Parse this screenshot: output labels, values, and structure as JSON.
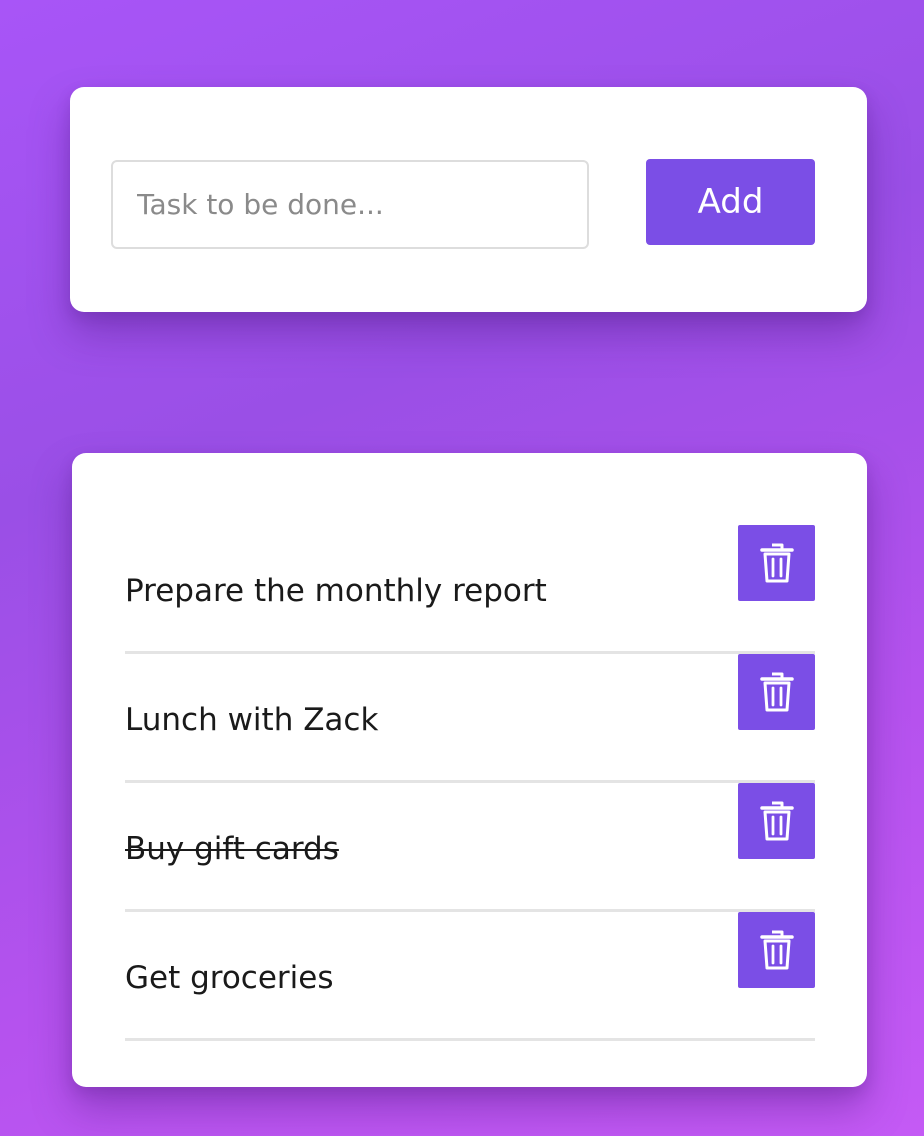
{
  "input_card": {
    "input_value": "",
    "input_placeholder": "Task to be done...",
    "add_label": "Add"
  },
  "tasks": [
    {
      "text": "Prepare the monthly report",
      "completed": false,
      "delete_icon": "trash-icon"
    },
    {
      "text": "Lunch with Zack",
      "completed": false,
      "delete_icon": "trash-icon"
    },
    {
      "text": "Buy gift cards",
      "completed": true,
      "delete_icon": "trash-icon"
    },
    {
      "text": "Get groceries",
      "completed": false,
      "delete_icon": "trash-icon"
    }
  ],
  "colors": {
    "accent": "#7b4ee6",
    "background_gradient_start": "#a855f7",
    "background_gradient_end": "#c45af5",
    "card": "#ffffff",
    "divider": "#e4e4e4"
  }
}
